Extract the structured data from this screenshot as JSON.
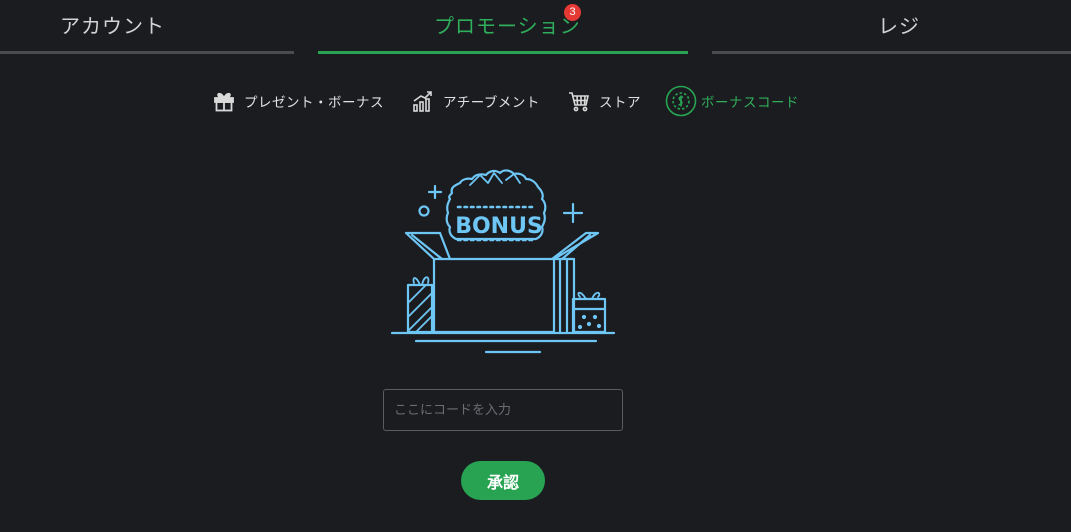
{
  "tabs": {
    "account": {
      "label": "アカウント"
    },
    "promotion": {
      "label": "プロモーション",
      "badge": "3"
    },
    "cashier": {
      "label": "レジ"
    }
  },
  "subnav": {
    "gift": {
      "label": "プレゼント・ボーナス",
      "icon": "gift-icon"
    },
    "achievement": {
      "label": "アチーブメント",
      "icon": "chart-growth-icon"
    },
    "store": {
      "label": "ストア",
      "icon": "cart-icon"
    },
    "bonus_code": {
      "label": "ボーナスコード",
      "icon": "coin-icon"
    }
  },
  "illustration": {
    "text": "BONUS",
    "icon": "bonus-box-icon"
  },
  "code_input": {
    "placeholder": "ここにコードを入力",
    "value": ""
  },
  "approve_button": {
    "label": "承認"
  },
  "colors": {
    "background": "#1b1c20",
    "accent": "#27a352",
    "illustration": "#6ec6f5",
    "badge": "#e53935"
  }
}
